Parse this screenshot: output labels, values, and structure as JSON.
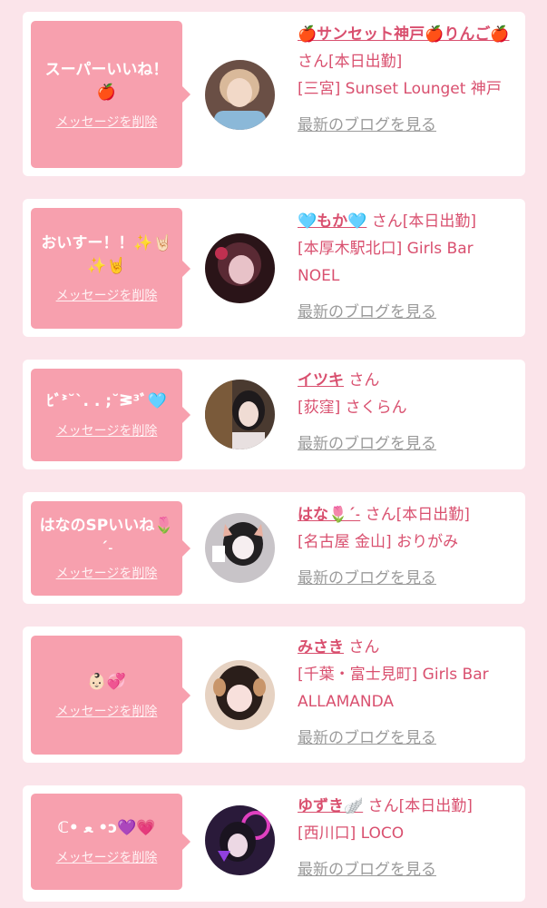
{
  "delete_label": "メッセージを削除",
  "blog_label": "最新のブログを見る",
  "colors": {
    "accent": "#d9506f",
    "bubble": "#f7a0ae",
    "background": "#fbe4ea"
  },
  "cards": [
    {
      "message": "スーパーいいね！🍎",
      "name": "🍎サンセット神戸🍎りんご🍎",
      "suffix": "さん[本日出勤]",
      "shop": "[三宮] Sunset Lounget 神戸"
    },
    {
      "message": "おいすー！！✨🤘🏻✨🤘",
      "name": "🩵もか🩵",
      "suffix": "さん[本日出勤]",
      "shop": "[本厚木駅北口] Girls Bar NOEL"
    },
    {
      "message": "ﾋﾞᕑ˘`. . ;˘ᕒ³ﾞ🩵",
      "name": "イツキ",
      "suffix": "さん",
      "shop": "[荻窪] さくらん"
    },
    {
      "message": "はなのSPいいね🌷ˊ˗",
      "name": "はな🌷ˊ˗",
      "suffix": "さん[本日出勤]",
      "shop": "[名古屋 金山] おりがみ"
    },
    {
      "message": "👶🏻💞",
      "name": "みさき",
      "suffix": "さん",
      "shop": "[千葉・富士見町] Girls Bar ALLAMANDA"
    },
    {
      "message": "ℂ• ﻌ •ɔ💜💗",
      "name": "ゆずき🪽",
      "suffix": "さん[本日出勤]",
      "shop": "[西川口] LOCO"
    }
  ]
}
